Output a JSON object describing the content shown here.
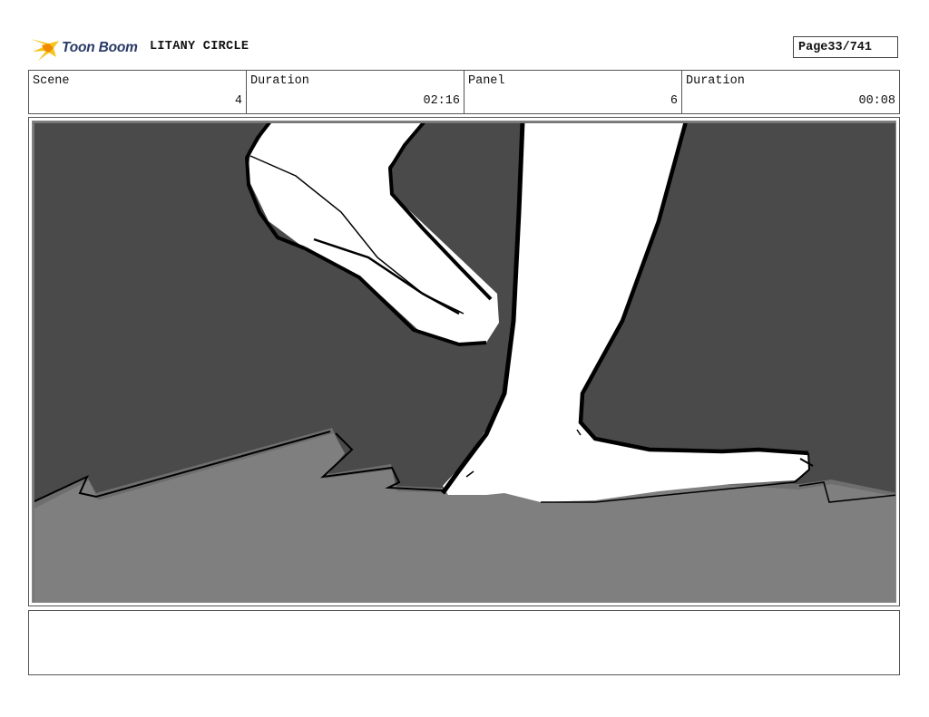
{
  "header": {
    "logo_text": "Toon Boom",
    "project_title": "LITANY CIRCLE",
    "page_label": "Page",
    "page_number": "33/741"
  },
  "info": {
    "scene_label": "Scene",
    "scene_value": "4",
    "scene_duration_label": "Duration",
    "scene_duration_value": "02:16",
    "panel_label": "Panel",
    "panel_value": "6",
    "panel_duration_label": "Duration",
    "panel_duration_value": "00:08"
  },
  "panel": {
    "colors": {
      "background": "#4a4a4a",
      "ground": "#7f7f7f",
      "ground_shadow": "#6e6e6e",
      "skin": "#ffffff",
      "line": "#000000"
    }
  },
  "notes": {
    "text": ""
  }
}
